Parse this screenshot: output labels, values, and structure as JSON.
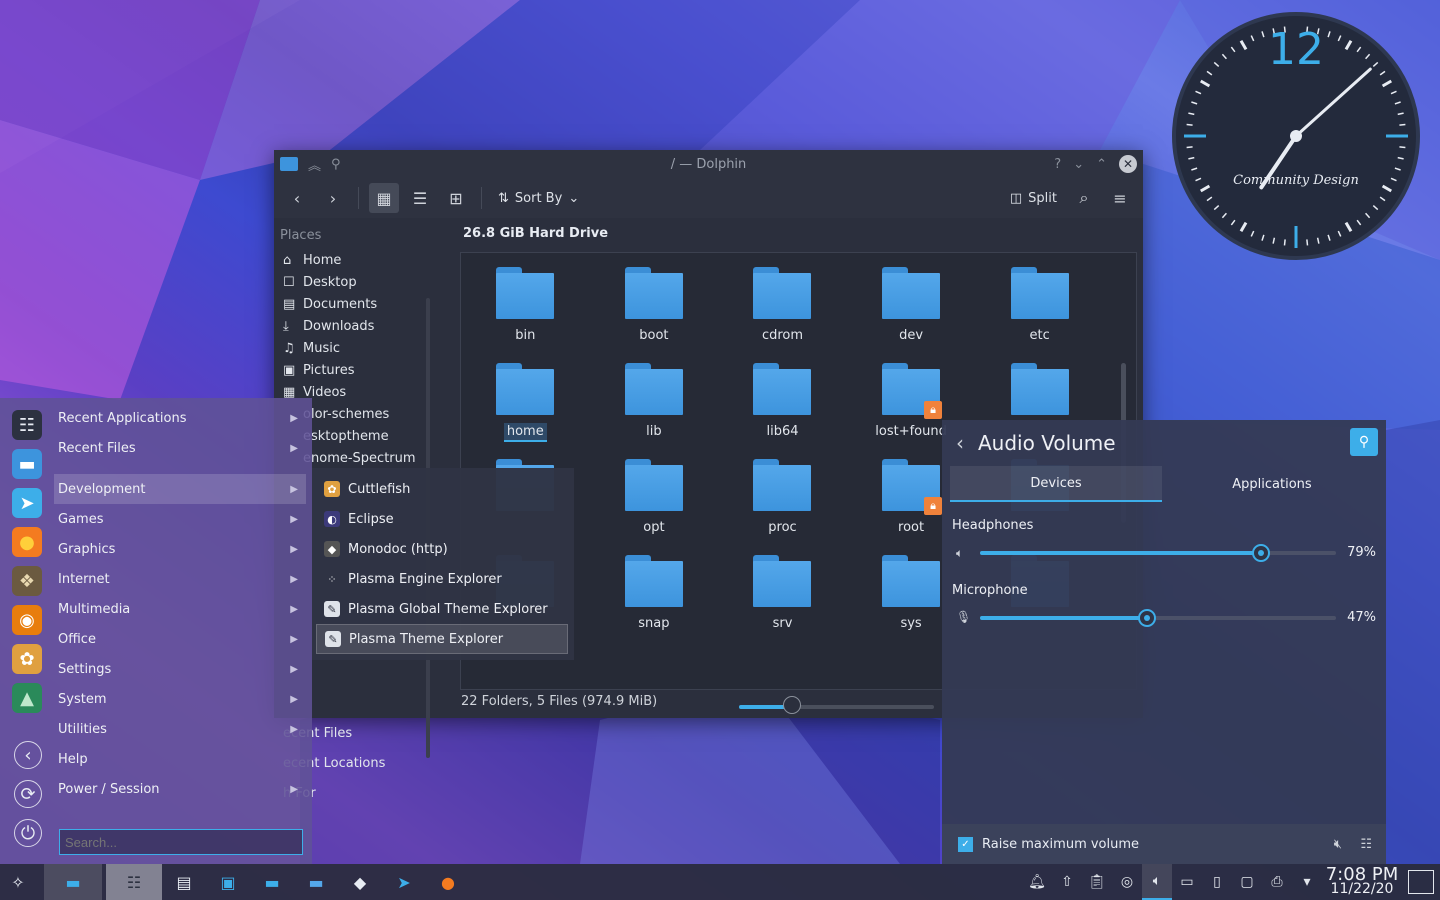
{
  "dolphin": {
    "title": "/ — Dolphin",
    "toolbar": {
      "sort_label": "Sort By",
      "split_label": "Split"
    },
    "places_header": "Places",
    "places": [
      {
        "icon": "home-icon",
        "glyph": "⌂",
        "label": "Home"
      },
      {
        "icon": "desktop-icon",
        "glyph": "☐",
        "label": "Desktop"
      },
      {
        "icon": "documents-icon",
        "glyph": "▤",
        "label": "Documents"
      },
      {
        "icon": "downloads-icon",
        "glyph": "⤓",
        "label": "Downloads"
      },
      {
        "icon": "music-icon",
        "glyph": "♫",
        "label": "Music"
      },
      {
        "icon": "pictures-icon",
        "glyph": "▣",
        "label": "Pictures"
      },
      {
        "icon": "videos-icon",
        "glyph": "▦",
        "label": "Videos"
      },
      {
        "icon": "folder-icon",
        "glyph": "",
        "label": "olor-schemes"
      },
      {
        "icon": "folder-icon",
        "glyph": "",
        "label": "esktoptheme"
      },
      {
        "icon": "folder-icon",
        "glyph": "",
        "label": "enome-Spectrum"
      }
    ],
    "places_lower": [
      "ecent Files",
      "ecent Locations",
      "h For"
    ],
    "drive_title": "26.8 GiB Hard Drive",
    "folders": [
      {
        "name": "bin"
      },
      {
        "name": "boot"
      },
      {
        "name": "cdrom"
      },
      {
        "name": "dev"
      },
      {
        "name": "etc"
      },
      {
        "name": "home",
        "selected": true
      },
      {
        "name": "lib"
      },
      {
        "name": "lib64"
      },
      {
        "name": "lost+found",
        "locked": true
      },
      {
        "name": ""
      },
      {
        "name": ""
      },
      {
        "name": "opt"
      },
      {
        "name": "proc"
      },
      {
        "name": "root",
        "locked": true
      },
      {
        "name": ""
      },
      {
        "name": ""
      },
      {
        "name": "snap"
      },
      {
        "name": "srv"
      },
      {
        "name": "sys"
      },
      {
        "name": ""
      }
    ],
    "status": "22 Folders, 5 Files (974.9 MiB)",
    "zoom_level": 0.27
  },
  "kickoff": {
    "categories": [
      {
        "label": "Recent Applications",
        "arrow": true
      },
      {
        "label": "Recent Files",
        "arrow": true
      },
      {
        "label": "Development",
        "arrow": true,
        "active": true
      },
      {
        "label": "Games",
        "arrow": true
      },
      {
        "label": "Graphics",
        "arrow": true
      },
      {
        "label": "Internet",
        "arrow": true
      },
      {
        "label": "Multimedia",
        "arrow": true
      },
      {
        "label": "Office",
        "arrow": true
      },
      {
        "label": "Settings",
        "arrow": true
      },
      {
        "label": "System",
        "arrow": true
      },
      {
        "label": "Utilities",
        "arrow": true
      },
      {
        "label": "Help",
        "arrow": false
      },
      {
        "label": "Power / Session",
        "arrow": true
      }
    ],
    "search_placeholder": "Search...",
    "sidebar_icons": [
      "system-settings-icon",
      "dolphin-icon",
      "discover-icon",
      "firefox-icon",
      "gimp-icon",
      "blender-icon",
      "cuttlefish-icon",
      "landscape-icon",
      "back-icon",
      "refresh-icon",
      "power-icon"
    ]
  },
  "submenu": {
    "items": [
      {
        "label": "Cuttlefish",
        "icon": "cuttlefish-icon"
      },
      {
        "label": "Eclipse",
        "icon": "eclipse-icon"
      },
      {
        "label": "Monodoc (http)",
        "icon": "monodoc-icon"
      },
      {
        "label": "Plasma Engine Explorer",
        "icon": "plasma-engine-icon"
      },
      {
        "label": "Plasma Global Theme Explorer",
        "icon": "theme-explorer-icon"
      },
      {
        "label": "Plasma Theme Explorer",
        "icon": "theme-explorer-icon",
        "highlighted": true
      }
    ]
  },
  "audio": {
    "title": "Audio Volume",
    "tabs": [
      {
        "label": "Devices",
        "active": true
      },
      {
        "label": "Applications",
        "active": false
      }
    ],
    "devices": [
      {
        "name": "Headphones",
        "volume": 79,
        "volume_label": "79%"
      },
      {
        "name": "Microphone",
        "volume": 47,
        "volume_label": "47%"
      }
    ],
    "raise_max_label": "Raise maximum volume",
    "raise_max_checked": true
  },
  "clock_widget": {
    "hour_label": "12",
    "brand": "Community Design",
    "hour": 7,
    "minute": 8
  },
  "panel": {
    "time": "7:08 PM",
    "date": "11/22/20",
    "tasks": [
      "app-launcher-icon",
      "dolphin-task-icon",
      "system-settings-task-icon",
      "terminal-icon",
      "discover-store-icon",
      "dolphin-icon",
      "folder-icon",
      "inkscape-icon",
      "discover-icon",
      "firefox-icon"
    ],
    "tray": [
      "notifications-icon",
      "updates-icon",
      "clipboard-icon",
      "vault-icon",
      "volume-icon",
      "network-icon",
      "usb-icon",
      "display-icon",
      "printer-icon",
      "expand-icon"
    ]
  },
  "colors": {
    "accent": "#3daee9",
    "folder": "#3d94dd",
    "lock": "#f0823b"
  }
}
